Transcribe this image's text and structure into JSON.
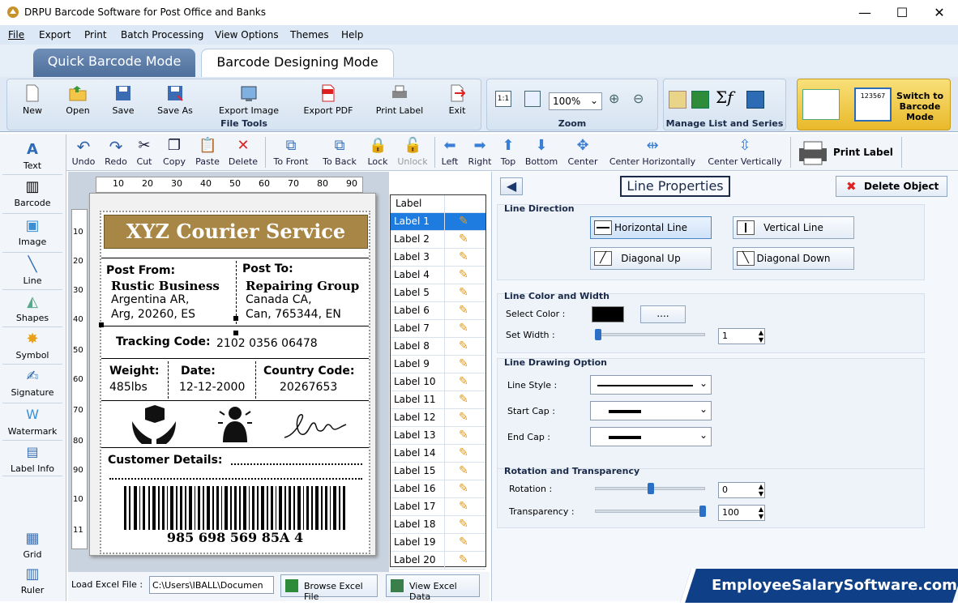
{
  "window": {
    "title": "DRPU Barcode Software for Post Office and Banks",
    "minimize": "—",
    "maximize": "☐",
    "close": "✕"
  },
  "menu": [
    "File",
    "Export",
    "Print",
    "Batch Processing",
    "View Options",
    "Themes",
    "Help"
  ],
  "modes": {
    "quick": "Quick Barcode Mode",
    "designing": "Barcode Designing Mode"
  },
  "ribbon": {
    "file_tools": {
      "title": "File Tools",
      "buttons": [
        "New",
        "Open",
        "Save",
        "Save As",
        "Export Image",
        "Export PDF",
        "Print Label",
        "Exit"
      ]
    },
    "zoom": {
      "title": "Zoom",
      "value": "100%"
    },
    "manage": {
      "title": "Manage List and Series"
    },
    "switch": {
      "label": "Switch to Barcode Mode",
      "sample_number": "123567"
    }
  },
  "toolbar": [
    "Undo",
    "Redo",
    "Cut",
    "Copy",
    "Paste",
    "Delete",
    "To Front",
    "To Back",
    "Lock",
    "Unlock",
    "Left",
    "Right",
    "Top",
    "Bottom",
    "Center",
    "Center Horizontally",
    "Center Vertically"
  ],
  "print_label": "Print Label",
  "sidebar": [
    "Text",
    "Barcode",
    "Image",
    "Line",
    "Shapes",
    "Symbol",
    "Signature",
    "Watermark",
    "Label Info",
    "Grid",
    "Ruler"
  ],
  "ruler": {
    "top": [
      "10",
      "20",
      "30",
      "40",
      "50",
      "60",
      "70",
      "80",
      "90"
    ],
    "left": [
      "10",
      "20",
      "30",
      "40",
      "50",
      "60",
      "70",
      "80",
      "90",
      "10",
      "11"
    ]
  },
  "label": {
    "header": "XYZ Courier Service",
    "from_title": "Post From:",
    "from_name": "Rustic Business",
    "from_line1": "Argentina AR,",
    "from_line2": "Arg, 20260, ES",
    "to_title": "Post To:",
    "to_name": "Repairing Group",
    "to_line1": "Canada CA,",
    "to_line2": "Can, 765344, EN",
    "tracking_title": "Tracking Code:",
    "tracking_value": "2102  0356  06478",
    "weight_title": "Weight:",
    "weight_value": "485lbs",
    "date_title": "Date:",
    "date_value": "12-12-2000",
    "country_title": "Country Code:",
    "country_value": "20267653",
    "customer_title": "Customer Details:",
    "barcode_value": "985 698 569 85A 4"
  },
  "label_list": {
    "header": "Label",
    "items": [
      "Label 1",
      "Label 2",
      "Label 3",
      "Label 4",
      "Label 5",
      "Label 6",
      "Label 7",
      "Label 8",
      "Label 9",
      "Label 10",
      "Label 11",
      "Label 12",
      "Label 13",
      "Label 14",
      "Label 15",
      "Label 16",
      "Label 17",
      "Label 18",
      "Label 19",
      "Label 20"
    ],
    "selected_index": 0
  },
  "bottom": {
    "load_label": "Load Excel File :",
    "path": "C:\\Users\\IBALL\\Documen",
    "browse": "Browse Excel File",
    "view": "View Excel Data"
  },
  "props": {
    "title": "Line Properties",
    "delete": "Delete Object",
    "direction_title": "Line Direction",
    "horizontal": "Horizontal Line",
    "vertical": "Vertical Line",
    "diag_up": "Diagonal Up",
    "diag_down": "Diagonal Down",
    "color_title": "Line Color and Width",
    "select_color": "Select Color :",
    "color_btn": "....",
    "color_value": "#000000",
    "set_width": "Set Width :",
    "width_value": "1",
    "drawing_title": "Line Drawing Option",
    "line_style": "Line Style :",
    "start_cap": "Start Cap :",
    "end_cap": "End Cap :",
    "rotation_title": "Rotation and Transparency",
    "rotation": "Rotation :",
    "rotation_value": "0",
    "transparency": "Transparency :",
    "transparency_value": "100"
  },
  "watermark": "EmployeeSalarySoftware.com"
}
